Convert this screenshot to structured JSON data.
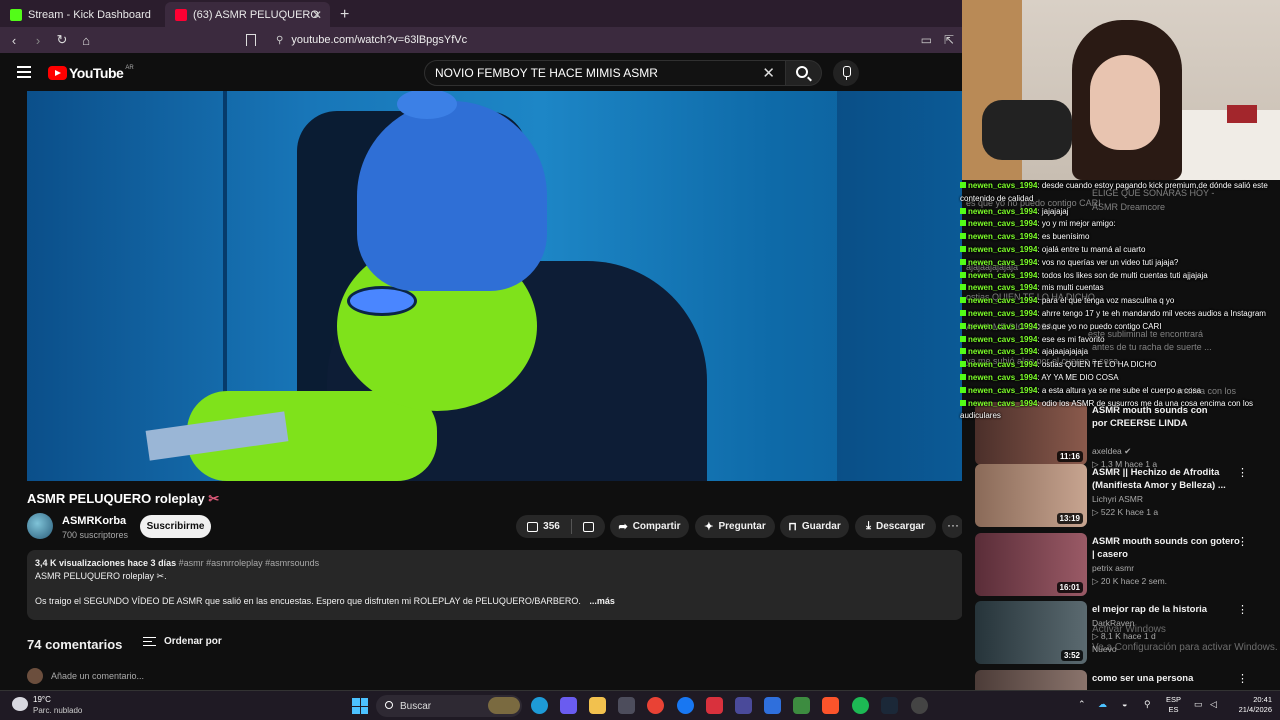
{
  "browser": {
    "tabs": [
      {
        "label": "Stream - Kick Dashboard",
        "color": "#53fc18"
      },
      {
        "label": "(63) ASMR PELUQUERO role",
        "color": "#ff0033"
      }
    ],
    "new_tab": "+",
    "url": "youtube.com/watch?v=63lBpgsYfVc"
  },
  "youtube": {
    "logo": "YouTube",
    "country": "AR",
    "search_value": "NOVIO FEMBOY TE HACE MIMIS ASMR"
  },
  "video": {
    "title": "ASMR PELUQUERO roleplay",
    "title_emoji": "✂",
    "channel": "ASMRKorba",
    "subscribers": "700 suscriptores",
    "subscribe_label": "Suscribirme",
    "likes": "356",
    "share_label": "Compartir",
    "ask_label": "Preguntar",
    "save_label": "Guardar",
    "download_label": "Descargar",
    "more_label": "···"
  },
  "description": {
    "stats": "3,4 K visualizaciones  hace 3 días",
    "tags": "#asmr #asmrroleplay #asmrsounds",
    "line1": "ASMR PELUQUERO roleplay ✂.",
    "body": "Os traigo el SEGUNDO VÍDEO DE ASMR que salió en las encuestas. Espero que disfruten mi ROLEPLAY de PELUQUERO/BARBERO.",
    "more": "...más"
  },
  "comments": {
    "count_label": "74 comentarios",
    "sort_label": "Ordenar por",
    "placeholder": "Añade un comentario..."
  },
  "chat": [
    {
      "user": "newen_cavs_1994",
      "text": ": desde cuando estoy pagando kick premium,de dónde salió este"
    },
    {
      "user": "",
      "text": "contenido de calidad"
    },
    {
      "user": "newen_cavs_1994",
      "text": ": jajajajaj"
    },
    {
      "user": "newen_cavs_1994",
      "text": ": yo y mi mejor amigo:"
    },
    {
      "user": "newen_cavs_1994",
      "text": ": es buenísimo"
    },
    {
      "user": "newen_cavs_1994",
      "text": ": ojalá entre tu mamá al cuarto"
    },
    {
      "user": "newen_cavs_1994",
      "text": ": vos no querías ver un video tuti jajaja?"
    },
    {
      "user": "newen_cavs_1994",
      "text": ": todos los likes son de multi cuentas tuti ajjajaja"
    },
    {
      "user": "newen_cavs_1994",
      "text": ": mis multi cuentas"
    },
    {
      "user": "newen_cavs_1994",
      "text": ": para el que tenga voz masculina q yo"
    },
    {
      "user": "newen_cavs_1994",
      "text": ": ahrre tengo 17 y te eh mandando mil veces audios a Instagram"
    },
    {
      "user": "newen_cavs_1994",
      "text": ": es que yo no puedo contigo CARI"
    },
    {
      "user": "newen_cavs_1994",
      "text": ": ese es mi favorito"
    },
    {
      "user": "newen_cavs_1994",
      "text": ": ajajaajajajaja"
    },
    {
      "user": "newen_cavs_1994",
      "text": ": ostias QUIEN TE LO HA DICHO"
    },
    {
      "user": "newen_cavs_1994",
      "text": ": AY YA ME DIO COSA"
    },
    {
      "user": "newen_cavs_1994",
      "text": ": a esta altura ya se me sube el cuerpo a cosa"
    },
    {
      "user": "newen_cavs_1994",
      "text": ": odio los ASMR de susurros me da una cosa encima con los"
    },
    {
      "user": "",
      "text": "audiculares"
    }
  ],
  "ghost_text": [
    "ELIGE QUE SONARÁS HOY -",
    "es que yo no puedo contigo CARI",
    "ASMR Dreamcore",
    "ajajaajajajaja",
    "ostias QUIEN TE LO HA DICHO",
    "AY YA ME DIO COSA",
    "este subliminal te encontrará",
    "antes de tu racha de suerte ...",
    "ya me subió algo por el cuerpo a cosa",
    "encima con los"
  ],
  "recommendations": [
    {
      "title": "ASMR mouth sounds con\npor CREERSE LINDA",
      "channel": "axeldea ✔",
      "meta": "▷ 1,3 M  hace 1 a",
      "duration": "11:16",
      "thumb": "#6a3f34",
      "dots": "⋮"
    },
    {
      "title": "ASMR || Hechizo de Afrodita (Manifiesta Amor y Belleza) ...",
      "channel": "Lichyri ASMR",
      "meta": "▷ 522 K  hace 1 a",
      "duration": "13:19",
      "thumb": "#b08b74",
      "dots": "⋮"
    },
    {
      "title": "ASMR mouth sounds con gotero | casero",
      "channel": "petrix asmr",
      "meta": "▷ 20 K  hace 2 sem.",
      "duration": "16:01",
      "thumb": "#7a3f4f",
      "dots": "⋮"
    },
    {
      "title": "el mejor rap de la historia",
      "channel": "DarkRaven",
      "meta": "▷ 8,1 K  hace 1 d",
      "badge": "Nuevo",
      "duration": "3:52",
      "thumb": "#3c4a4f",
      "dots": "⋮"
    },
    {
      "title": "como ser una persona",
      "channel": "",
      "meta": "",
      "duration": "",
      "thumb": "#6c5a55",
      "dots": "⋮"
    }
  ],
  "windows": {
    "watermark1": "Activar Windows",
    "watermark2": "Ve a Configuración para activar Windows.",
    "temp": "19°C",
    "cond": "Parc. nublado",
    "search": "Buscar",
    "lang1": "ESP",
    "lang2": "ES",
    "time": "20:41",
    "date": "21/4/2026"
  }
}
